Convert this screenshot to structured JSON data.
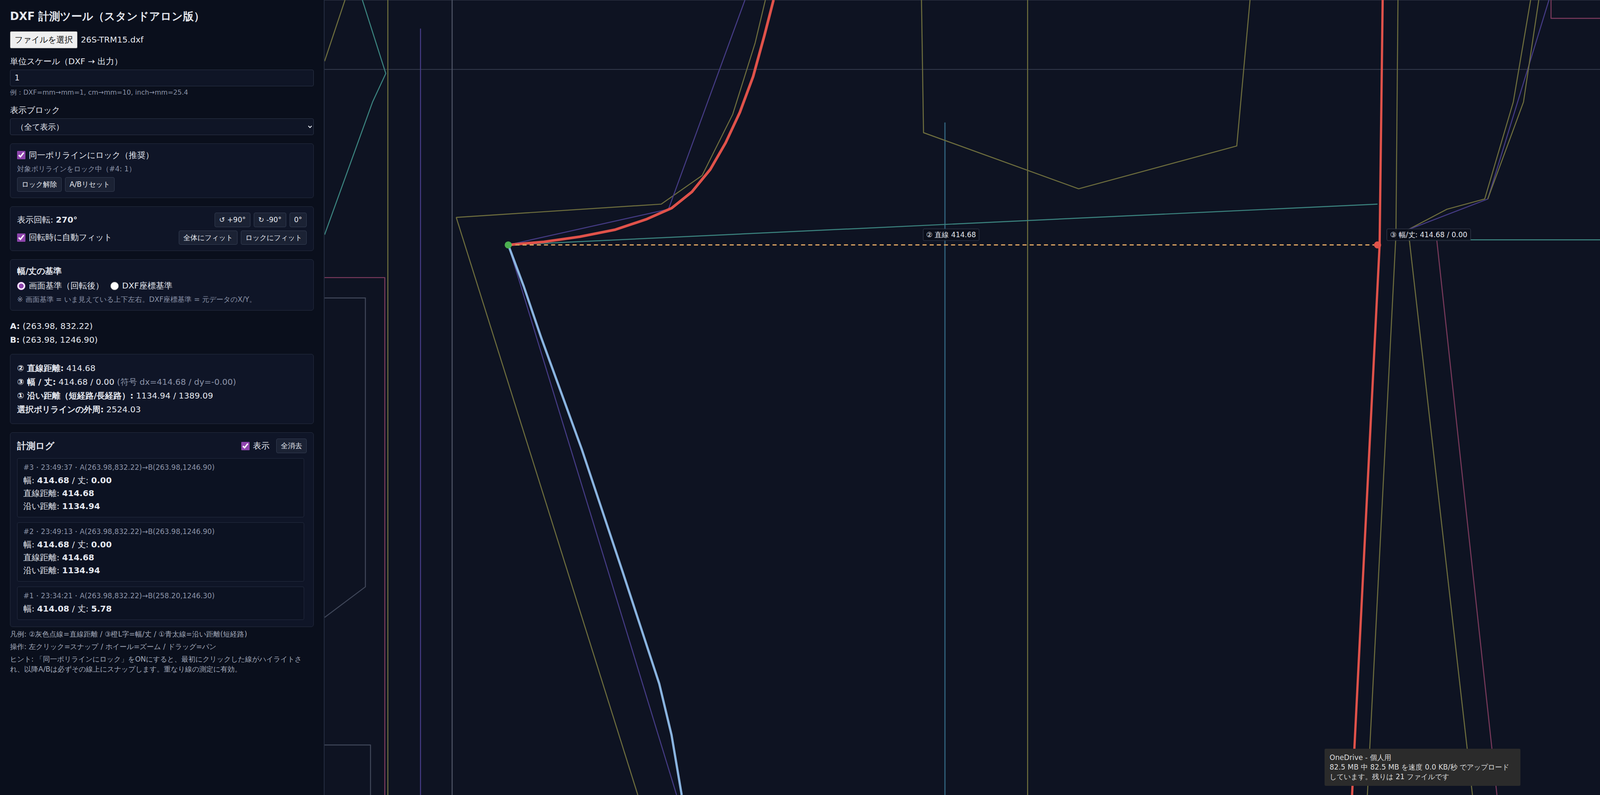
{
  "window": {
    "title": "DXF 計測ツール（スタンドアロン版）"
  },
  "file": {
    "button": "ファイルを選択",
    "name": "26S-TRM15.dxf"
  },
  "scale": {
    "label": "単位スケール（DXF → 出力）",
    "value": "1",
    "hint": "例：DXF=mm→mm=1, cm→mm=10, inch→mm=25.4"
  },
  "block": {
    "label": "表示ブロック",
    "value": "（全て表示）"
  },
  "lock": {
    "label": "同一ポリラインにロック（推奨）",
    "checked": true,
    "status": "対象ポリラインをロック中（#4: 1）",
    "buttons": [
      "ロック解除",
      "A/Bリセット"
    ]
  },
  "rotation": {
    "label": "表示回転:",
    "value": "270°",
    "buttons": [
      "↺ +90°",
      "↻ -90°",
      "0°"
    ],
    "autofit": {
      "label": "回転時に自動フィット",
      "checked": true
    },
    "fit_buttons": [
      "全体にフィット",
      "ロックにフィット"
    ]
  },
  "basis": {
    "title": "幅/丈の基準",
    "options": [
      {
        "label": "画面基準（回転後）",
        "selected": true
      },
      {
        "label": "DXF座標基準",
        "selected": false
      }
    ],
    "note": "※ 画面基準 = いま見えている上下左右。DXF座標基準 = 元データのX/Y。"
  },
  "points": [
    {
      "label": "A:",
      "value": "(263.98, 832.22)"
    },
    {
      "label": "B:",
      "value": "(263.98, 1246.90)"
    }
  ],
  "results": [
    {
      "label": "② 直線距離:",
      "value": "414.68",
      "extra": ""
    },
    {
      "label": "③ 幅 / 丈:",
      "value": "414.68 / 0.00",
      "extra": "(符号 dx=414.68 / dy=-0.00)"
    },
    {
      "label": "① 沿い距離（短経路/長経路）:",
      "value": "1134.94 / 1389.09",
      "extra": ""
    },
    {
      "label": "選択ポリラインの外周:",
      "value": "2524.03",
      "extra": ""
    }
  ],
  "log": {
    "title": "計測ログ",
    "show": {
      "label": "表示",
      "checked": true
    },
    "clear": "全消去",
    "entries": [
      {
        "header": "#3・23:49:37・A(263.98,832.22)→B(263.98,1246.90)",
        "lines": [
          [
            {
              "text": "幅: ",
              "kind": "label"
            },
            {
              "text": "414.68",
              "kind": "value"
            },
            {
              "text": " / 丈: ",
              "kind": "label"
            },
            {
              "text": "0.00",
              "kind": "value"
            }
          ],
          [
            {
              "text": "直線距離: ",
              "kind": "label"
            },
            {
              "text": "414.68",
              "kind": "value"
            }
          ],
          [
            {
              "text": "沿い距離: ",
              "kind": "label"
            },
            {
              "text": "1134.94",
              "kind": "value"
            }
          ]
        ]
      },
      {
        "header": "#2・23:49:13・A(263.98,832.22)→B(263.98,1246.90)",
        "lines": [
          [
            {
              "text": "幅: ",
              "kind": "label"
            },
            {
              "text": "414.68",
              "kind": "value"
            },
            {
              "text": " / 丈: ",
              "kind": "label"
            },
            {
              "text": "0.00",
              "kind": "value"
            }
          ],
          [
            {
              "text": "直線距離: ",
              "kind": "label"
            },
            {
              "text": "414.68",
              "kind": "value"
            }
          ],
          [
            {
              "text": "沿い距離: ",
              "kind": "label"
            },
            {
              "text": "1134.94",
              "kind": "value"
            }
          ]
        ]
      },
      {
        "header": "#1・23:34:21・A(263.98,832.22)→B(258.20,1246.30)",
        "lines": [
          [
            {
              "text": "幅: ",
              "kind": "label"
            },
            {
              "text": "414.08",
              "kind": "value"
            },
            {
              "text": " / 丈: ",
              "kind": "label"
            },
            {
              "text": "5.78",
              "kind": "value"
            }
          ]
        ]
      }
    ]
  },
  "footer": [
    "凡例: ②灰色点線=直線距離 / ③橙L字=幅/丈 / ①青太線=沿い距離(短経路)",
    "操作: 左クリック=スナップ / ホイール=ズーム / ドラッグ=パン",
    "ヒント: 「同一ポリラインにロック」をONにすると、最初にクリックした線がハイライトされ、以降A/Bは必ずその線上にスナップします。重なり線の測定に有効。"
  ],
  "canvas": {
    "labels": [
      "② 直線 414.68",
      "③ 幅/丈: 414.68 / 0.00"
    ],
    "markers": [
      {
        "name": "A",
        "color": "#4caf50"
      },
      {
        "name": "B",
        "color": "#e0524a"
      }
    ]
  },
  "toast": {
    "title": "OneDrive - 個人用",
    "text": "82.5 MB 中 82.5 MB を速度 0.0 KB/秒 でアップロードしています。残りは 21 ファイルです"
  }
}
